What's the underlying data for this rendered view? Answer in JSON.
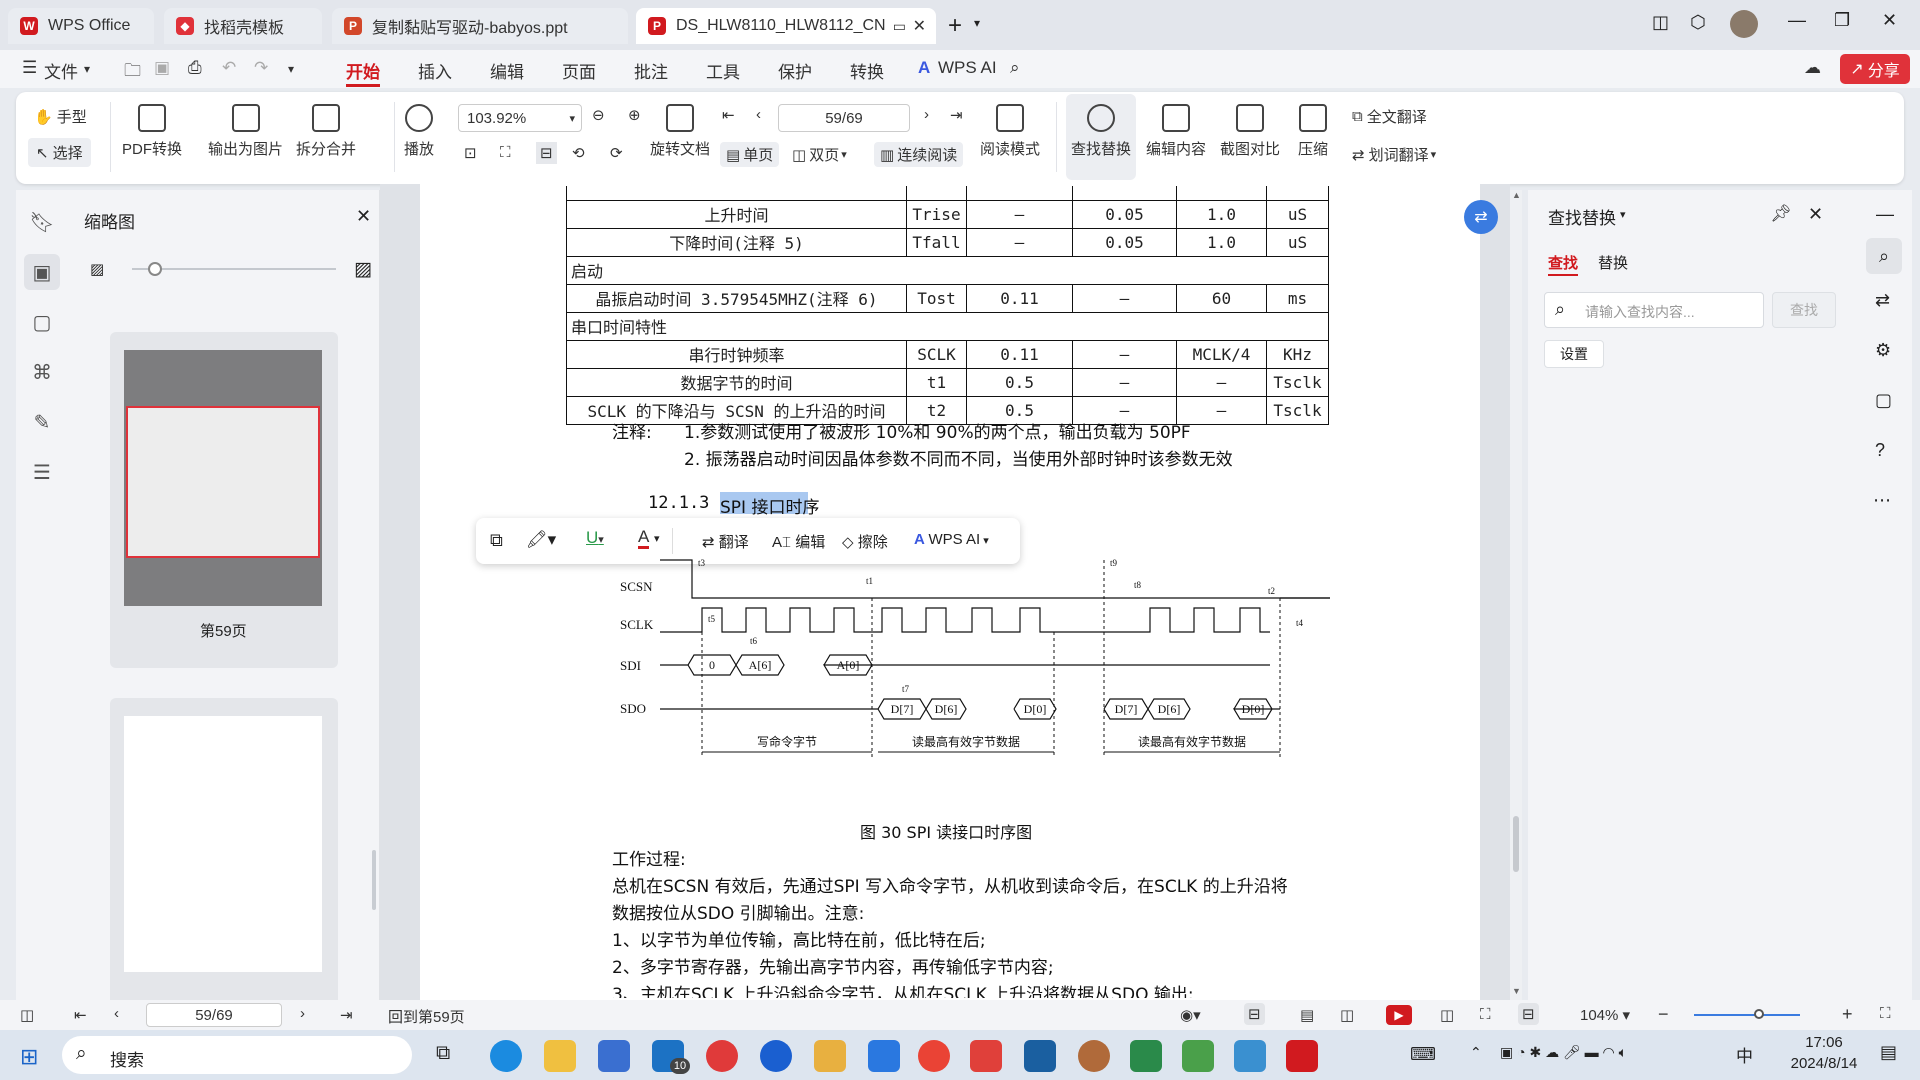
{
  "tabs": [
    {
      "label": "WPS Office",
      "icon": "wps-logo-icon"
    },
    {
      "label": "找稻壳模板",
      "icon": "docer-icon"
    },
    {
      "label": "复制黏贴写驱动-babyos.ppt",
      "icon": "ppt-icon"
    },
    {
      "label": "DS_HLW8110_HLW8112_CN",
      "icon": "pdf-icon"
    }
  ],
  "menu": {
    "file": "文件",
    "items": [
      "开始",
      "插入",
      "编辑",
      "页面",
      "批注",
      "工具",
      "保护",
      "转换"
    ],
    "wpsai": "WPS AI",
    "share": "分享"
  },
  "ribbon": {
    "hand": "手型",
    "select": "选择",
    "pdf_convert": "PDF转换",
    "export_img": "输出为图片",
    "split_merge": "拆分合并",
    "play": "播放",
    "zoom": "103.92%",
    "rotate": "旋转文档",
    "single": "单页",
    "double": "双页",
    "continuous": "连续阅读",
    "page": "59/69",
    "reading": "阅读模式",
    "find_replace": "查找替换",
    "edit_content": "编辑内容",
    "screenshot_compare": "截图对比",
    "compress": "压缩",
    "full_translate": "全文翻译",
    "word_translate": "划词翻译"
  },
  "thumb_panel": {
    "title": "缩略图",
    "page_label": "第59页"
  },
  "doc": {
    "table": [
      [
        "上升时间",
        "Trise",
        "–",
        "0.05",
        "1.0",
        "uS"
      ],
      [
        "下降时间(注释 5)",
        "Tfall",
        "–",
        "0.05",
        "1.0",
        "uS"
      ],
      [
        "启动"
      ],
      [
        "晶振启动时间 3.579545MHZ(注释 6)",
        "Tost",
        "0.11",
        "–",
        "60",
        "ms"
      ],
      [
        "串口时间特性"
      ],
      [
        "串行时钟频率",
        "SCLK",
        "0.11",
        "–",
        "MCLK/4",
        "KHz"
      ],
      [
        "数据字节的时间",
        "t1",
        "0.5",
        "–",
        "–",
        "Tsclk"
      ],
      [
        "SCLK 的下降沿与 SCSN 的上升沿的时间",
        "t2",
        "0.5",
        "–",
        "–",
        "Tsclk"
      ]
    ],
    "note_label": "注释:",
    "note1": "1.参数测试使用了被波形 10%和 90%的两个点，输出负载为 50PF",
    "note2": "2. 振荡器启动时间因晶体参数不同而不同，当使用外部时钟时该参数无效",
    "section_num": "12.1.3",
    "section_title": "SPI 接口时序",
    "figure_caption": "图 30 SPI 读接口时序图",
    "para_title": "工作过程:",
    "para1": "总机在SCSN 有效后，先通过SPI 写入命令字节，从机收到读命令后，在SCLK 的上升沿将",
    "para2": "数据按位从SDO 引脚输出。注意:",
    "para3": "1、以字节为单位传输，高比特在前，低比特在后;",
    "para4": "2、多字节寄存器，先输出高字节内容，再传输低字节内容;",
    "para5": "3、主机在SCLK 上升沿斜命令字节，从机在SCLK 上升沿将数据从SDO 输出:",
    "timing": {
      "signals": [
        "SCSN",
        "SCLK",
        "SDI",
        "SDO"
      ],
      "sdi": [
        "0",
        "A[6]",
        "A[0]"
      ],
      "sdo": [
        "D[7]",
        "D[6]",
        "D[0]",
        "D[7]",
        "D[6]",
        "D[0]"
      ],
      "labels": [
        "t3",
        "t1",
        "t9",
        "t8",
        "t2",
        "t5",
        "t6",
        "t4",
        "t7"
      ],
      "spans": [
        "写命令字节",
        "读最高有效字节数据",
        "读最高有效字节数据"
      ]
    }
  },
  "float_toolbar": {
    "translate": "翻译",
    "edit": "编辑",
    "erase": "擦除",
    "wpsai": "WPS AI"
  },
  "right_panel": {
    "title": "查找替换",
    "tab_find": "查找",
    "tab_replace": "替换",
    "placeholder": "请输入查找内容...",
    "find_btn": "查找",
    "settings": "设置"
  },
  "status": {
    "page": "59/69",
    "back": "回到第59页",
    "zoom": "104%"
  },
  "taskbar": {
    "search": "搜索",
    "time": "17:06",
    "date": "2024/8/14",
    "ime": "中",
    "badge": "10"
  }
}
